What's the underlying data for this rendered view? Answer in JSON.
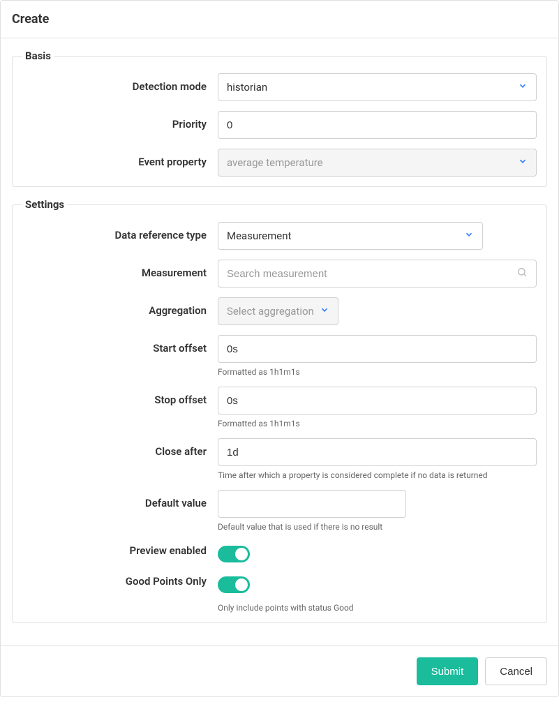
{
  "header": {
    "title": "Create"
  },
  "basis": {
    "legend": "Basis",
    "detectionMode": {
      "label": "Detection mode",
      "value": "historian"
    },
    "priority": {
      "label": "Priority",
      "value": "0"
    },
    "eventProperty": {
      "label": "Event property",
      "value": "average temperature"
    }
  },
  "settings": {
    "legend": "Settings",
    "dataReferenceType": {
      "label": "Data reference type",
      "value": "Measurement"
    },
    "measurement": {
      "label": "Measurement",
      "placeholder": "Search measurement"
    },
    "aggregation": {
      "label": "Aggregation",
      "placeholder": "Select aggregation"
    },
    "startOffset": {
      "label": "Start offset",
      "value": "0s",
      "help": "Formatted as 1h1m1s"
    },
    "stopOffset": {
      "label": "Stop offset",
      "value": "0s",
      "help": "Formatted as 1h1m1s"
    },
    "closeAfter": {
      "label": "Close after",
      "value": "1d",
      "help": "Time after which a property is considered complete if no data is returned"
    },
    "defaultValue": {
      "label": "Default value",
      "value": "",
      "help": "Default value that is used if there is no result"
    },
    "previewEnabled": {
      "label": "Preview enabled",
      "value": true
    },
    "goodPointsOnly": {
      "label": "Good Points Only",
      "value": true,
      "help": "Only include points with status Good"
    }
  },
  "footer": {
    "submit": "Submit",
    "cancel": "Cancel"
  }
}
